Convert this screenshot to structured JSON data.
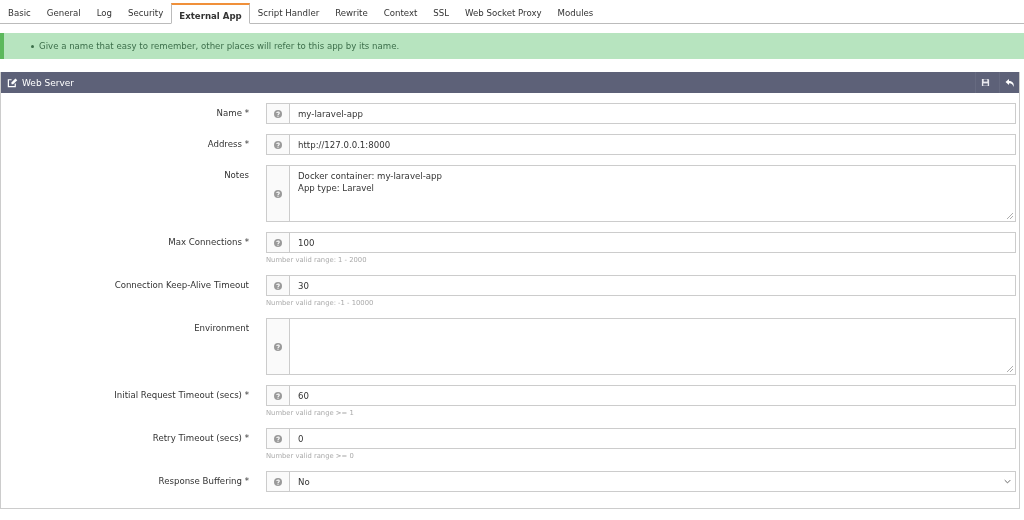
{
  "tabs": [
    {
      "label": "Basic",
      "selected": false
    },
    {
      "label": "General",
      "selected": false
    },
    {
      "label": "Log",
      "selected": false
    },
    {
      "label": "Security",
      "selected": false
    },
    {
      "label": "External App",
      "selected": true
    },
    {
      "label": "Script Handler",
      "selected": false
    },
    {
      "label": "Rewrite",
      "selected": false
    },
    {
      "label": "Context",
      "selected": false
    },
    {
      "label": "SSL",
      "selected": false
    },
    {
      "label": "Web Socket Proxy",
      "selected": false
    },
    {
      "label": "Modules",
      "selected": false
    }
  ],
  "alert": {
    "items": [
      "Give a name that easy to remember, other places will refer to this app by its name."
    ]
  },
  "panel": {
    "title": "Web Server",
    "fields": [
      {
        "kind": "text",
        "label": "Name *",
        "value": "my-laravel-app"
      },
      {
        "kind": "text",
        "label": "Address *",
        "value": "http://127.0.0.1:8000"
      },
      {
        "kind": "textarea",
        "label": "Notes",
        "value": "Docker container: my-laravel-app\nApp type: Laravel"
      },
      {
        "kind": "text",
        "label": "Max Connections *",
        "value": "100",
        "hint": "Number valid range: 1 - 2000"
      },
      {
        "kind": "text",
        "label": "Connection Keep-Alive Timeout",
        "value": "30",
        "hint": "Number valid range: -1 - 10000"
      },
      {
        "kind": "textarea",
        "label": "Environment"
      },
      {
        "kind": "text",
        "label": "Initial Request Timeout (secs) *",
        "value": "60",
        "hint": "Number valid range >= 1"
      },
      {
        "kind": "text",
        "label": "Retry Timeout (secs) *",
        "value": "0",
        "hint": "Number valid range >= 0"
      },
      {
        "kind": "select",
        "label": "Response Buffering *",
        "value": "No"
      }
    ]
  }
}
